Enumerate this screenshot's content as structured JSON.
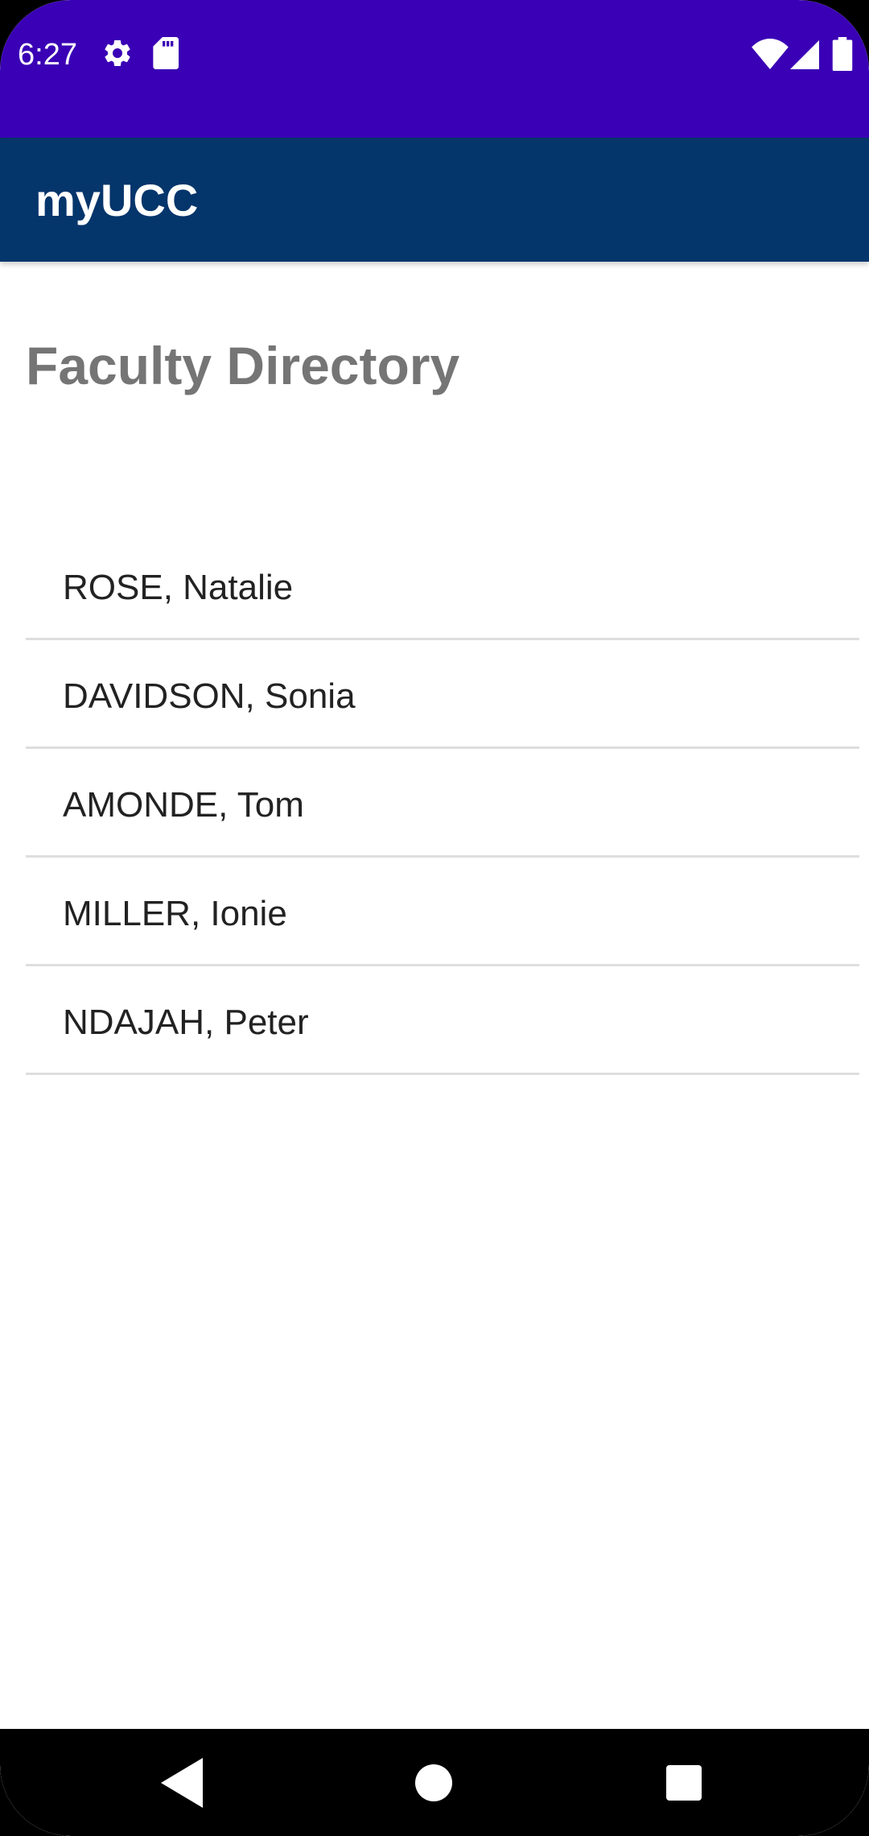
{
  "status_bar": {
    "time": "6:27",
    "color": "#3a00b5",
    "icons": [
      "gear-icon",
      "sd-card-icon",
      "wifi-icon",
      "signal-icon",
      "battery-icon"
    ]
  },
  "app_bar": {
    "title": "myUCC",
    "color": "#04356b"
  },
  "page": {
    "heading": "Faculty Directory"
  },
  "faculty": [
    {
      "name": "ROSE, Natalie"
    },
    {
      "name": "DAVIDSON, Sonia"
    },
    {
      "name": "AMONDE, Tom"
    },
    {
      "name": "MILLER, Ionie"
    },
    {
      "name": "NDAJAH, Peter"
    }
  ],
  "nav_bar": {
    "buttons": [
      "back",
      "home",
      "recents"
    ]
  }
}
